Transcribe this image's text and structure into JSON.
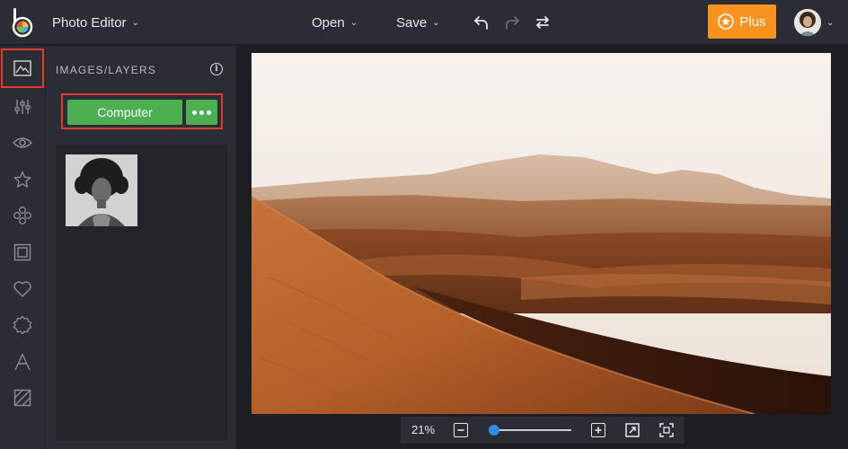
{
  "header": {
    "app_title": "Photo Editor",
    "menus": [
      {
        "label": "Open"
      },
      {
        "label": "Save"
      }
    ],
    "plus_label": "Plus"
  },
  "panel": {
    "title": "IMAGES/LAYERS",
    "info_glyph": "i",
    "computer_label": "Computer"
  },
  "rail": {
    "items": [
      {
        "name": "image-icon",
        "active": true
      },
      {
        "name": "adjustments-icon"
      },
      {
        "name": "eye-icon"
      },
      {
        "name": "star-icon"
      },
      {
        "name": "overlays-icon"
      },
      {
        "name": "frame-icon"
      },
      {
        "name": "heart-icon"
      },
      {
        "name": "badge-icon"
      },
      {
        "name": "text-icon"
      },
      {
        "name": "texture-icon"
      }
    ]
  },
  "zoom": {
    "percent": "21%",
    "level": 0.07
  },
  "colors": {
    "accent_orange": "#f7931e",
    "accent_green": "#4caf50",
    "highlight_red": "#e03a2d",
    "slider_blue": "#2f8ce8"
  }
}
